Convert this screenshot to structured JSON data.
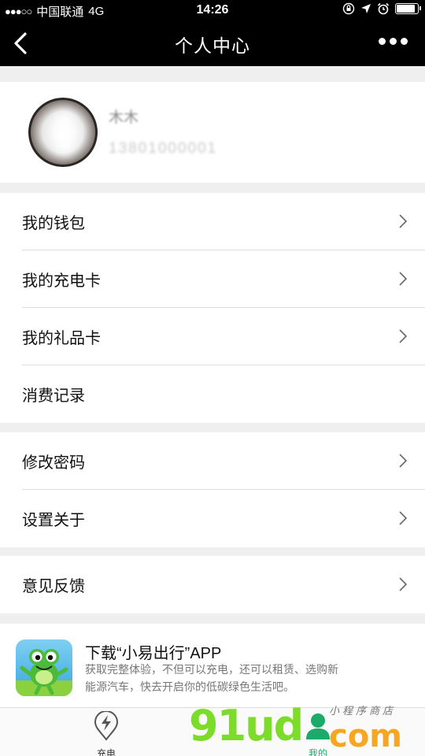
{
  "status_bar": {
    "signal": "●●●○○",
    "carrier": "中国联通",
    "network": "4G",
    "time": "14:26",
    "icons": [
      "orientation-lock-icon",
      "location-arrow-icon",
      "alarm-icon",
      "battery-icon"
    ],
    "battery_level": 0.9
  },
  "nav": {
    "title": "个人中心",
    "back_icon": "back-chevron-icon",
    "more_icon": "more-dots-icon"
  },
  "profile": {
    "name": "木木",
    "phone": "13801000001"
  },
  "menu_groups": [
    [
      {
        "label": "我的钱包",
        "chevron": true
      },
      {
        "label": "我的充电卡",
        "chevron": true
      },
      {
        "label": "我的礼品卡",
        "chevron": true
      },
      {
        "label": "消费记录",
        "chevron": false
      }
    ],
    [
      {
        "label": "修改密码",
        "chevron": true
      },
      {
        "label": "设置关于",
        "chevron": true
      }
    ],
    [
      {
        "label": "意见反馈",
        "chevron": true
      }
    ]
  ],
  "banner": {
    "title": "下载“小易出行”APP",
    "description": "获取完整体验，不但可以充电，还可以租赁、选购新能源汽车，快去开启你的低碳绿色生活吧。"
  },
  "tabs": [
    {
      "label": "充电",
      "icon": "charging-pin-icon",
      "active": false
    },
    {
      "label": "我的",
      "icon": "user-icon",
      "active": true
    }
  ],
  "watermark": {
    "main": "91ud",
    "com": "com",
    "sub": "小程序商店"
  },
  "colors": {
    "accent": "#1aab6a",
    "nav_bg": "#000000",
    "page_bg": "#efefef"
  }
}
